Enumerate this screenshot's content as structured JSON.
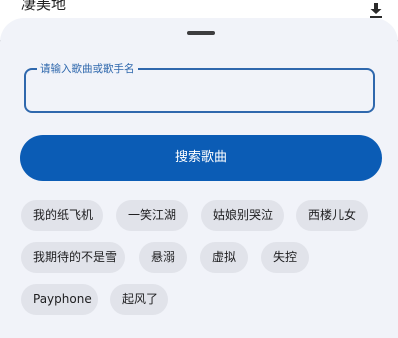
{
  "background": {
    "title": "凄美地",
    "download_icon": "download-icon"
  },
  "search": {
    "label": "请输入歌曲或歌手名",
    "value": "",
    "placeholder": ""
  },
  "search_button": {
    "label": "搜索歌曲"
  },
  "suggestions": [
    "我的纸飞机",
    "一笑江湖",
    "姑娘别哭泣",
    "西楼儿女",
    "我期待的不是雪",
    "悬溺",
    "虚拟",
    "失控",
    "Payphone",
    "起风了"
  ],
  "colors": {
    "accent": "#0b5cb5",
    "field_border": "#2f68ad",
    "sheet_bg": "#f1f3f9",
    "chip_bg": "#e1e3ea"
  }
}
